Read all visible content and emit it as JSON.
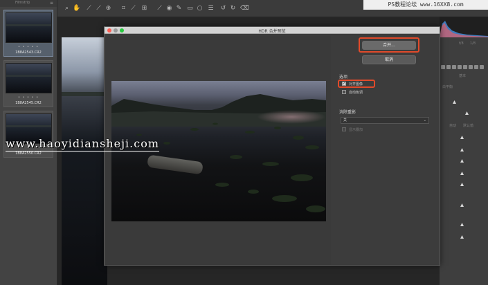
{
  "filmstrip": {
    "title": "Filmstrip",
    "thumbnails": [
      {
        "name": "1B8A2543.CR2",
        "stars": "• • • • •",
        "selected": true
      },
      {
        "name": "1B8A2545.CR2",
        "stars": "• • • • •",
        "selected": false
      },
      {
        "name": "1B8A2550.CR2",
        "stars": "• • • • •",
        "selected": false
      }
    ]
  },
  "toolbar": {
    "tools": [
      "zoom-icon",
      "hand-icon",
      "white-balance-icon",
      "color-sampler-icon",
      "targeted-adjust-icon",
      "crop-icon",
      "straighten-icon",
      "transform-icon",
      "spot-removal-icon",
      "red-eye-icon",
      "adjustment-brush-icon",
      "graduated-filter-icon",
      "radial-filter-icon",
      "preferences-icon",
      "rotate-left-icon",
      "rotate-right-icon",
      "trash-icon"
    ]
  },
  "dialog": {
    "title": "HDR 合并预览",
    "merge_button": "合并...",
    "cancel_button": "取消",
    "options_label": "选项",
    "align_images": {
      "label": "对齐图像",
      "checked": true
    },
    "auto_tone": {
      "label": "自动色调",
      "checked": false
    },
    "deghost_label": "消除重影",
    "deghost_value": "关",
    "show_overlay": {
      "label": "显示叠加",
      "checked": false,
      "disabled": true
    }
  },
  "right_panel": {
    "small_labels": [
      "f/8",
      "1/8"
    ],
    "basic_label": "基本",
    "white_balance_label": "白平衡",
    "auto_label": "自动",
    "default_label": "默认值"
  },
  "watermarks": {
    "site": "www.haoyidiansheji.com",
    "corner": "PS教程论坛 www.16XX8.com"
  },
  "colors": {
    "highlight": "#e24a2a",
    "traffic_close": "#ff5f56",
    "traffic_min": "#9a9a9a",
    "traffic_zoom": "#27c93f"
  }
}
